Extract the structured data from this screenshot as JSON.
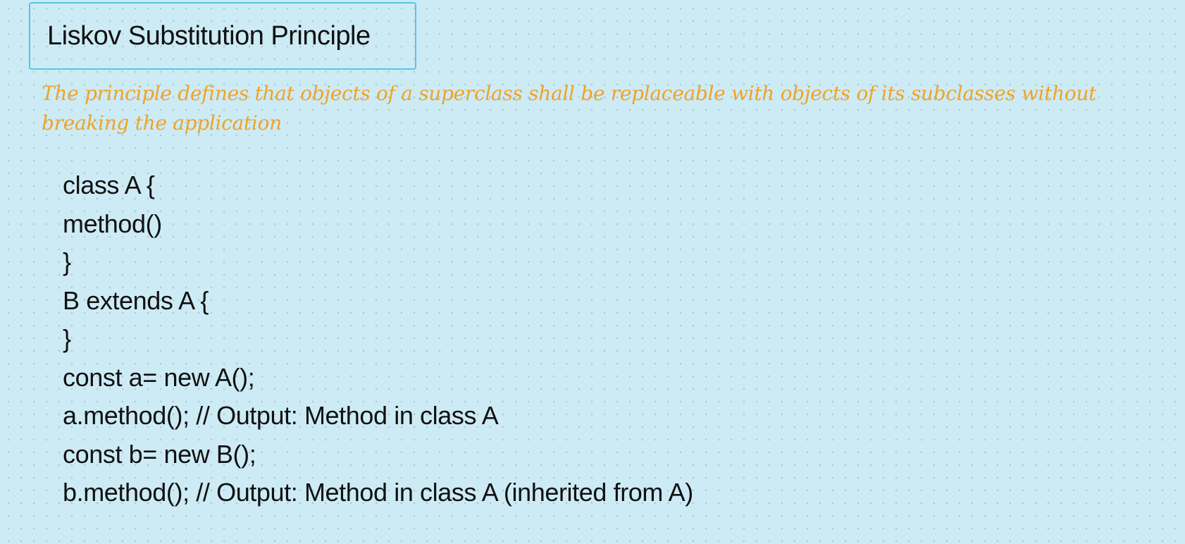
{
  "title": "Liskov Substitution Principle",
  "note": "The principle defines that objects of a superclass shall be replaceable with objects of its subclasses without breaking the application",
  "code_lines": [
    "class A {",
    "method()",
    "}",
    "B extends A {",
    "}",
    "const a= new A();",
    "a.method(); // Output: Method in class A",
    "const b= new B();",
    "b.method(); // Output: Method in class A (inherited from A)"
  ],
  "colors": {
    "background": "#cdebf5",
    "title_border": "#58c3e8",
    "note_text": "#f0a326",
    "text": "#111111"
  }
}
